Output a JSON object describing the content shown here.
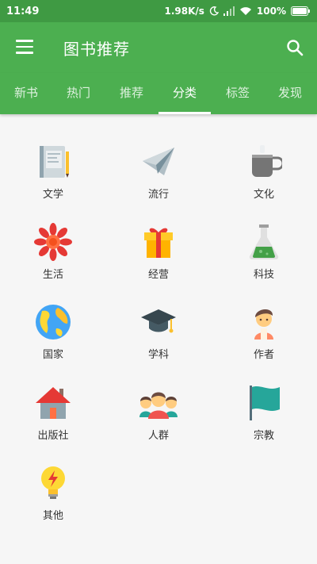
{
  "status": {
    "time": "11:49",
    "speed": "1.98K/s",
    "battery": "100%"
  },
  "appbar": {
    "title": "图书推荐",
    "menu_icon": "menu-icon",
    "search_icon": "search-icon"
  },
  "tabs": [
    {
      "label": "新书",
      "active": false
    },
    {
      "label": "热门",
      "active": false
    },
    {
      "label": "推荐",
      "active": false
    },
    {
      "label": "分类",
      "active": true
    },
    {
      "label": "标签",
      "active": false
    },
    {
      "label": "发现",
      "active": false
    }
  ],
  "categories": [
    {
      "label": "文学",
      "icon": "book-icon"
    },
    {
      "label": "流行",
      "icon": "paper-plane-icon"
    },
    {
      "label": "文化",
      "icon": "teacup-icon"
    },
    {
      "label": "生活",
      "icon": "flower-icon"
    },
    {
      "label": "经营",
      "icon": "gift-icon"
    },
    {
      "label": "科技",
      "icon": "flask-icon"
    },
    {
      "label": "国家",
      "icon": "globe-icon"
    },
    {
      "label": "学科",
      "icon": "graduation-cap-icon"
    },
    {
      "label": "作者",
      "icon": "person-icon"
    },
    {
      "label": "出版社",
      "icon": "house-icon"
    },
    {
      "label": "人群",
      "icon": "people-icon"
    },
    {
      "label": "宗教",
      "icon": "flag-icon"
    },
    {
      "label": "其他",
      "icon": "lightbulb-icon"
    }
  ],
  "colors": {
    "statusbar": "#3f9a43",
    "primary": "#4caf50",
    "background": "#f6f6f6"
  }
}
